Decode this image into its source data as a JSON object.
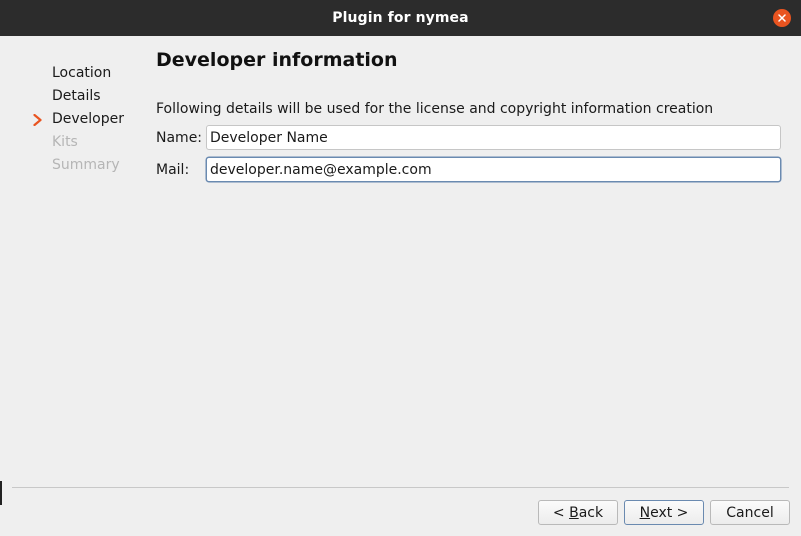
{
  "window": {
    "title": "Plugin for nymea"
  },
  "sidebar": {
    "steps": [
      {
        "label": "Location",
        "state": "done"
      },
      {
        "label": "Details",
        "state": "done"
      },
      {
        "label": "Developer",
        "state": "current"
      },
      {
        "label": "Kits",
        "state": "pending"
      },
      {
        "label": "Summary",
        "state": "pending"
      }
    ]
  },
  "page": {
    "heading": "Developer information",
    "description": "Following details will be used for the license and copyright information creation",
    "name_label": "Name:",
    "name_value": "Developer Name",
    "mail_label": "Mail:",
    "mail_value": "developer.name@example.com"
  },
  "buttons": {
    "back_prefix": "< ",
    "back_mnemonic": "B",
    "back_rest": "ack",
    "next_mnemonic": "N",
    "next_rest": "ext >",
    "cancel": "Cancel"
  },
  "colors": {
    "titlebar": "#2c2c2c",
    "close_button": "#e95420",
    "current_step_arrow": "#e95420",
    "focus_border": "#6a8ab0"
  }
}
